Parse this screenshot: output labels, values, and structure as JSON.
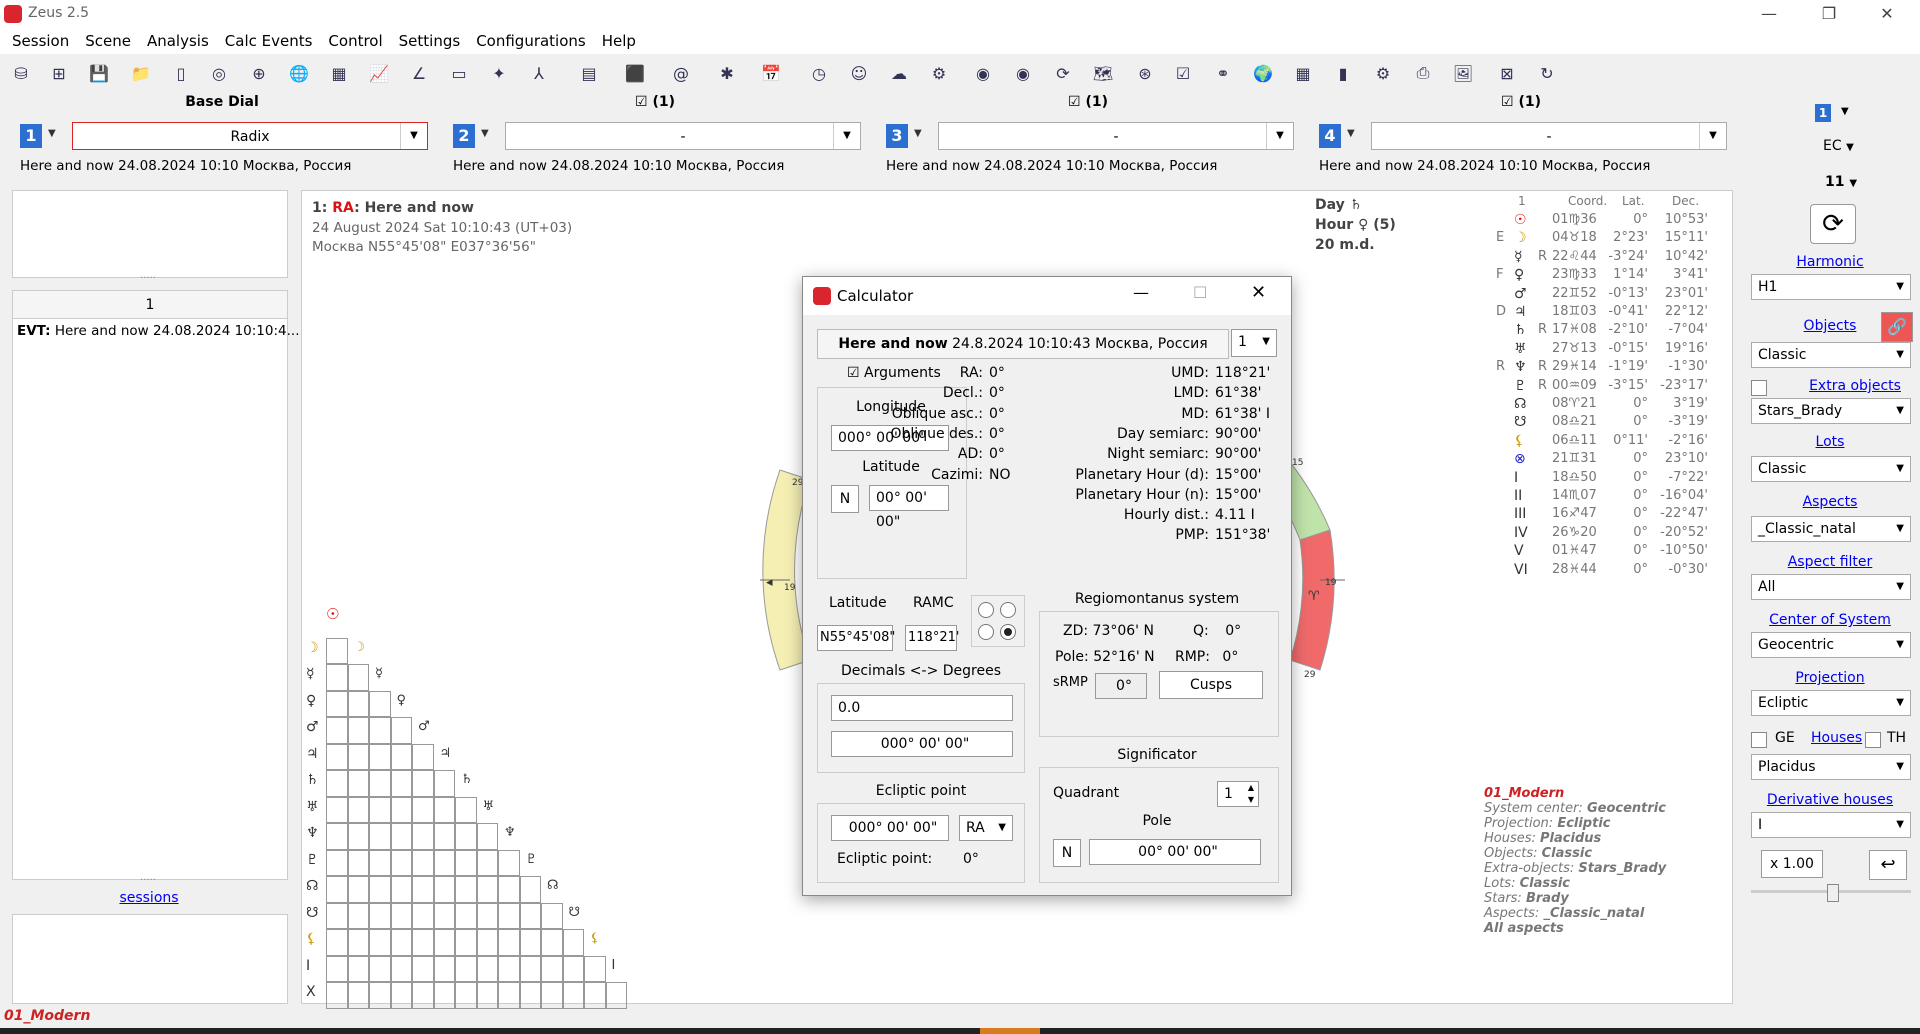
{
  "app": {
    "title": "Zeus  2.5"
  },
  "menu": [
    "Session",
    "Scene",
    "Analysis",
    "Calc Events",
    "Control",
    "Settings",
    "Configurations",
    "Help"
  ],
  "dials": [
    {
      "header": "Base Dial",
      "num": "1",
      "combo": "Radix",
      "info": "Here and now 24.08.2024 10:10 Москва, Россия"
    },
    {
      "header": "(1)",
      "num": "2",
      "combo": "-",
      "info": "Here and now 24.08.2024 10:10 Москва, Россия"
    },
    {
      "header": "(1)",
      "num": "3",
      "combo": "-",
      "info": "Here and now 24.08.2024 10:10 Москва, Россия"
    },
    {
      "header": "(1)",
      "num": "4",
      "combo": "-",
      "info": "Here and now 24.08.2024 10:10 Москва, Россия"
    }
  ],
  "left": {
    "tab_number": "1",
    "event_prefix": "EVT:",
    "event_text": "Here and now 24.08.2024 10:10:4...",
    "sessions_link": "sessions"
  },
  "chart": {
    "header_prefix": "1: ",
    "header_ra": "RA",
    "header_title": ": Here and now",
    "date_line": "24 August 2024 Sat 10:10:43 (UT+03)",
    "place_line": "Москва N55°45'08\" E037°36'56\"",
    "day_label": "Day ♄",
    "hour_label": "Hour ♀ (5)",
    "md_label": "20 m.d.",
    "wheel_ticks": [
      "29",
      "15",
      "19",
      "29",
      "19"
    ],
    "wheel_glyph": "♈"
  },
  "planet_table": {
    "headers": [
      "1",
      "Coord.",
      "Lat.",
      "Dec."
    ],
    "rows": [
      {
        "mark": "",
        "glyph": "☉",
        "r": "",
        "coord": "01♍36",
        "lat": "0°",
        "dec": "10°53'",
        "color": "#d11"
      },
      {
        "mark": "E",
        "glyph": "☽",
        "r": "",
        "coord": "04♉18",
        "lat": "2°23'",
        "dec": "15°11'",
        "color": "#c90"
      },
      {
        "mark": "",
        "glyph": "☿",
        "r": "R",
        "coord": "22♌44",
        "lat": "-3°24'",
        "dec": "10°42'",
        "color": "#333"
      },
      {
        "mark": "F",
        "glyph": "♀",
        "r": "",
        "coord": "23♍33",
        "lat": "1°14'",
        "dec": "3°41'",
        "color": "#333"
      },
      {
        "mark": "",
        "glyph": "♂",
        "r": "",
        "coord": "22♊52",
        "lat": "-0°13'",
        "dec": "23°01'",
        "color": "#333"
      },
      {
        "mark": "D",
        "glyph": "♃",
        "r": "",
        "coord": "18♊03",
        "lat": "-0°41'",
        "dec": "22°12'",
        "color": "#333"
      },
      {
        "mark": "",
        "glyph": "♄",
        "r": "R",
        "coord": "17♓08",
        "lat": "-2°10'",
        "dec": "-7°04'",
        "color": "#333"
      },
      {
        "mark": "",
        "glyph": "♅",
        "r": "",
        "coord": "27♉13",
        "lat": "-0°15'",
        "dec": "19°16'",
        "color": "#333"
      },
      {
        "mark": "R",
        "glyph": "♆",
        "r": "R",
        "coord": "29♓14",
        "lat": "-1°19'",
        "dec": "-1°30'",
        "color": "#333"
      },
      {
        "mark": "",
        "glyph": "♇",
        "r": "R",
        "coord": "00♒09",
        "lat": "-3°15'",
        "dec": "-23°17'",
        "color": "#333"
      },
      {
        "mark": "",
        "glyph": "☊",
        "r": "",
        "coord": "08♈21",
        "lat": "0°",
        "dec": "3°19'",
        "color": "#333"
      },
      {
        "mark": "",
        "glyph": "☋",
        "r": "",
        "coord": "08♎21",
        "lat": "0°",
        "dec": "-3°19'",
        "color": "#333"
      },
      {
        "mark": "",
        "glyph": "⚸",
        "r": "",
        "coord": "06♎11",
        "lat": "0°11'",
        "dec": "-2°16'",
        "color": "#c90"
      },
      {
        "mark": "",
        "glyph": "⊗",
        "r": "",
        "coord": "21♊31",
        "lat": "0°",
        "dec": "23°10'",
        "color": "#22c"
      },
      {
        "mark": "",
        "glyph": "I",
        "r": "",
        "coord": "18♎50",
        "lat": "0°",
        "dec": "-7°22'",
        "color": "#333"
      },
      {
        "mark": "",
        "glyph": "II",
        "r": "",
        "coord": "14♏07",
        "lat": "0°",
        "dec": "-16°04'",
        "color": "#333"
      },
      {
        "mark": "",
        "glyph": "III",
        "r": "",
        "coord": "16♐47",
        "lat": "0°",
        "dec": "-22°47'",
        "color": "#333"
      },
      {
        "mark": "",
        "glyph": "IV",
        "r": "",
        "coord": "26♑20",
        "lat": "0°",
        "dec": "-20°52'",
        "color": "#333"
      },
      {
        "mark": "",
        "glyph": "V",
        "r": "",
        "coord": "01♓47",
        "lat": "0°",
        "dec": "-10°50'",
        "color": "#333"
      },
      {
        "mark": "",
        "glyph": "VI",
        "r": "",
        "coord": "28♓44",
        "lat": "0°",
        "dec": "-0°30'",
        "color": "#333"
      }
    ]
  },
  "grid_glyphs": [
    "☉",
    "☽",
    "☿",
    "♀",
    "♂",
    "♃",
    "♄",
    "♅",
    "♆",
    "♇",
    "☊",
    "☋",
    "⚸",
    "I",
    "X"
  ],
  "config_info": {
    "name": "01_Modern",
    "lines": [
      {
        "label": "System center: ",
        "value": "Geocentric"
      },
      {
        "label": "Projection: ",
        "value": "Ecliptic"
      },
      {
        "label": "Houses: ",
        "value": "Placidus"
      },
      {
        "label": "Objects: ",
        "value": "Classic"
      },
      {
        "label": "Extra-objects: ",
        "value": "Stars_Brady"
      },
      {
        "label": "Lots: ",
        "value": "Classic"
      },
      {
        "label": "Stars: ",
        "value": "Brady"
      },
      {
        "label": "Aspects: ",
        "value": "_Classic_natal"
      }
    ],
    "last": "All aspects"
  },
  "right": {
    "badge": "1",
    "ec": "EC",
    "num11": "11",
    "harmonic_link": "Harmonic",
    "harmonic_val": "H1",
    "objects_link": "Objects",
    "objects_val": "Classic",
    "extra_link": "Extra objects",
    "extra_val": "Stars_Brady",
    "lots_link": "Lots",
    "lots_val": "Classic",
    "aspects_link": "Aspects",
    "aspects_val": "_Classic_natal",
    "aspect_filter_link": "Aspect filter",
    "aspect_filter_val": "All",
    "center_link": "Center of System",
    "center_val": "Geocentric",
    "projection_link": "Projection",
    "projection_val": "Ecliptic",
    "ge_label": "GE",
    "houses_link": "Houses",
    "th_label": "TH",
    "houses_val": "Placidus",
    "deriv_link": "Derivative houses",
    "deriv_val": "I",
    "zoom": "x 1.00"
  },
  "calc": {
    "title": "Calculator",
    "header_bold": "Here and now",
    "header_text": " 24.8.2024 10:10:43 Москва, Россия",
    "header_num": "1",
    "arguments_label": "Arguments",
    "longitude_label": "Longitude",
    "longitude_val": "000° 00' 00\"",
    "latitude_label": "Latitude",
    "lat_ns": "N",
    "latitude_val": "00° 00' 00\"",
    "left_params": [
      {
        "k": "RA:",
        "v": "0°"
      },
      {
        "k": "Decl.:",
        "v": "0°"
      },
      {
        "k": "Oblique asc.:",
        "v": "0°"
      },
      {
        "k": "Oblique des.:",
        "v": "0°"
      },
      {
        "k": "AD:",
        "v": "0°"
      },
      {
        "k": "Cazimi:",
        "v": "NO"
      }
    ],
    "right_params": [
      {
        "k": "UMD:",
        "v": "118°21'"
      },
      {
        "k": "LMD:",
        "v": "61°38'"
      },
      {
        "k": "MD:",
        "v": "61°38' I"
      },
      {
        "k": "Day semiarc:",
        "v": "90°00'"
      },
      {
        "k": "Night semiarc:",
        "v": "90°00'"
      },
      {
        "k": "Planetary  Hour (d):",
        "v": "15°00'"
      },
      {
        "k": "Planetary  Hour (n):",
        "v": "15°00'"
      },
      {
        "k": "Hourly dist.:",
        "v": "4.11 I"
      },
      {
        "k": "PMP:",
        "v": "151°38'"
      }
    ],
    "lat2_label": "Latitude",
    "ramc_label": "RAMC",
    "lat2_val": "N55°45'08\"",
    "ramc_val": "118°21'",
    "decdeg_label": "Decimals <-> Degrees",
    "dec_val": "0.0",
    "deg_val": "000° 00' 00\"",
    "ecl_label": "Ecliptic point",
    "ecl_val": "000° 00' 00\"",
    "ecl_sel": "RA",
    "ecl_point_label": "Ecliptic point:",
    "ecl_point_val": "0°",
    "regio_label": "Regiomontanus system",
    "zd_k": "ZD:",
    "zd_v": "73°06' N",
    "q_k": "Q:",
    "q_v": "0°",
    "pole_k": "Pole:",
    "pole_v": "52°16' N",
    "rmp_k": "RMP:",
    "rmp_v": "0°",
    "srmp_k": "sRMP",
    "srmp_v": "0°",
    "cusps_btn": "Cusps",
    "signif_label": "Significator",
    "quadrant_label": "Quadrant",
    "quadrant_val": "1",
    "pole_label": "Pole",
    "pole_ns": "N",
    "pole_val": "00° 00' 00\""
  },
  "status": "01_Modern"
}
